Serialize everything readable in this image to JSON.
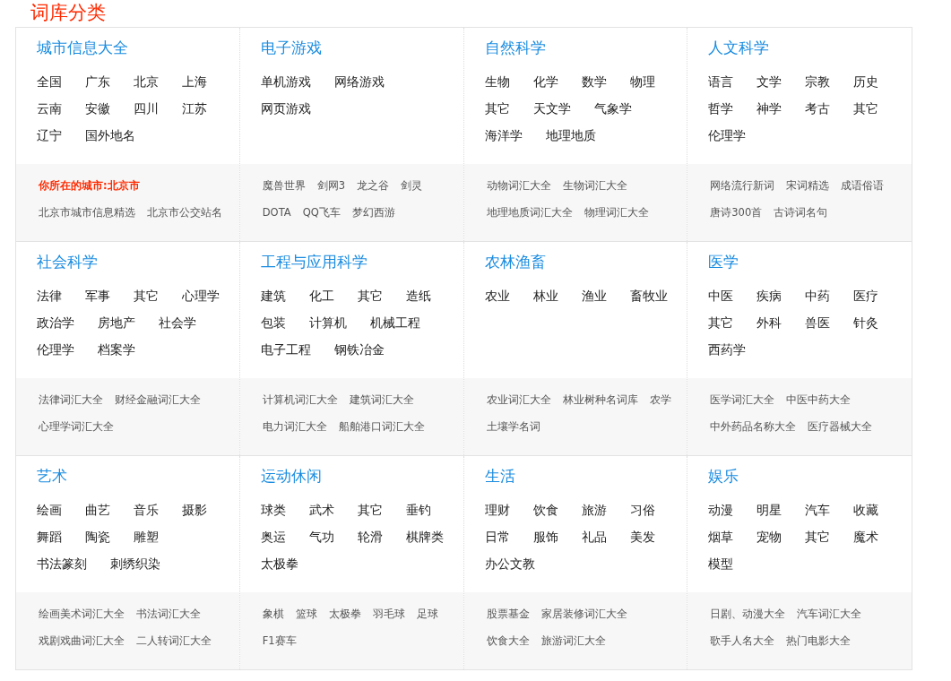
{
  "title": "词库分类",
  "categories": [
    {
      "name": "城市信息大全",
      "items": [
        "全国",
        "广东",
        "北京",
        "上海",
        "云南",
        "安徽",
        "四川",
        "江苏",
        "辽宁",
        "国外地名"
      ],
      "links": [
        [
          {
            "text": "你所在的城市:北京市",
            "kind": "location"
          }
        ],
        [
          {
            "text": "北京市城市信息精选",
            "kind": "link"
          },
          {
            "text": "北京市公交站名",
            "kind": "link"
          }
        ]
      ]
    },
    {
      "name": "电子游戏",
      "items": [
        "单机游戏",
        "网络游戏",
        "网页游戏"
      ],
      "links": [
        [
          {
            "text": "魔兽世界",
            "kind": "link"
          },
          {
            "text": "剑网3",
            "kind": "link"
          },
          {
            "text": "龙之谷",
            "kind": "link"
          },
          {
            "text": "剑灵",
            "kind": "link"
          }
        ],
        [
          {
            "text": "DOTA",
            "kind": "link"
          },
          {
            "text": "QQ飞车",
            "kind": "link"
          },
          {
            "text": "梦幻西游",
            "kind": "link"
          }
        ]
      ]
    },
    {
      "name": "自然科学",
      "items": [
        "生物",
        "化学",
        "数学",
        "物理",
        "其它",
        "天文学",
        "气象学",
        "海洋学",
        "地理地质"
      ],
      "links": [
        [
          {
            "text": "动物词汇大全",
            "kind": "link"
          },
          {
            "text": "生物词汇大全",
            "kind": "link"
          }
        ],
        [
          {
            "text": "地理地质词汇大全",
            "kind": "link"
          },
          {
            "text": "物理词汇大全",
            "kind": "link"
          }
        ]
      ]
    },
    {
      "name": "人文科学",
      "items": [
        "语言",
        "文学",
        "宗教",
        "历史",
        "哲学",
        "神学",
        "考古",
        "其它",
        "伦理学"
      ],
      "links": [
        [
          {
            "text": "网络流行新词",
            "kind": "link"
          },
          {
            "text": "宋词精选",
            "kind": "link"
          },
          {
            "text": "成语俗语",
            "kind": "link"
          }
        ],
        [
          {
            "text": "唐诗300首",
            "kind": "link"
          },
          {
            "text": "古诗词名句",
            "kind": "link"
          }
        ]
      ]
    },
    {
      "name": "社会科学",
      "items": [
        "法律",
        "军事",
        "其它",
        "心理学",
        "政治学",
        "房地产",
        "社会学",
        "伦理学",
        "档案学"
      ],
      "links": [
        [
          {
            "text": "法律词汇大全",
            "kind": "link"
          },
          {
            "text": "财经金融词汇大全",
            "kind": "link"
          }
        ],
        [
          {
            "text": "心理学词汇大全",
            "kind": "link"
          }
        ]
      ]
    },
    {
      "name": "工程与应用科学",
      "items": [
        "建筑",
        "化工",
        "其它",
        "造纸",
        "包装",
        "计算机",
        "机械工程",
        "电子工程",
        "钢铁冶金"
      ],
      "links": [
        [
          {
            "text": "计算机词汇大全",
            "kind": "link"
          },
          {
            "text": "建筑词汇大全",
            "kind": "link"
          }
        ],
        [
          {
            "text": "电力词汇大全",
            "kind": "link"
          },
          {
            "text": "船舶港口词汇大全",
            "kind": "link"
          }
        ]
      ]
    },
    {
      "name": "农林渔畜",
      "items": [
        "农业",
        "林业",
        "渔业",
        "畜牧业"
      ],
      "links": [
        [
          {
            "text": "农业词汇大全",
            "kind": "link"
          },
          {
            "text": "林业树种名词库",
            "kind": "link"
          },
          {
            "text": "农学",
            "kind": "link"
          }
        ],
        [
          {
            "text": "土壤学名词",
            "kind": "link"
          }
        ]
      ]
    },
    {
      "name": "医学",
      "items": [
        "中医",
        "疾病",
        "中药",
        "医疗",
        "其它",
        "外科",
        "兽医",
        "针灸",
        "西药学"
      ],
      "links": [
        [
          {
            "text": "医学词汇大全",
            "kind": "link"
          },
          {
            "text": "中医中药大全",
            "kind": "link"
          }
        ],
        [
          {
            "text": "中外药品名称大全",
            "kind": "link"
          },
          {
            "text": "医疗器械大全",
            "kind": "link"
          }
        ]
      ]
    },
    {
      "name": "艺术",
      "items": [
        "绘画",
        "曲艺",
        "音乐",
        "摄影",
        "舞蹈",
        "陶瓷",
        "雕塑",
        "书法篆刻",
        "刺绣织染"
      ],
      "links": [
        [
          {
            "text": "绘画美术词汇大全",
            "kind": "link"
          },
          {
            "text": "书法词汇大全",
            "kind": "link"
          }
        ],
        [
          {
            "text": "戏剧戏曲词汇大全",
            "kind": "link"
          },
          {
            "text": "二人转词汇大全",
            "kind": "link"
          }
        ]
      ]
    },
    {
      "name": "运动休闲",
      "items": [
        "球类",
        "武术",
        "其它",
        "垂钓",
        "奥运",
        "气功",
        "轮滑",
        "棋牌类",
        "太极拳"
      ],
      "links": [
        [
          {
            "text": "象棋",
            "kind": "link"
          },
          {
            "text": "篮球",
            "kind": "link"
          },
          {
            "text": "太极拳",
            "kind": "link"
          },
          {
            "text": "羽毛球",
            "kind": "link"
          },
          {
            "text": "足球",
            "kind": "link"
          }
        ],
        [
          {
            "text": "F1赛车",
            "kind": "link"
          }
        ]
      ]
    },
    {
      "name": "生活",
      "items": [
        "理财",
        "饮食",
        "旅游",
        "习俗",
        "日常",
        "服饰",
        "礼品",
        "美发",
        "办公文教"
      ],
      "links": [
        [
          {
            "text": "股票基金",
            "kind": "link"
          },
          {
            "text": "家居装修词汇大全",
            "kind": "link"
          }
        ],
        [
          {
            "text": "饮食大全",
            "kind": "link"
          },
          {
            "text": "旅游词汇大全",
            "kind": "link"
          }
        ]
      ]
    },
    {
      "name": "娱乐",
      "items": [
        "动漫",
        "明星",
        "汽车",
        "收藏",
        "烟草",
        "宠物",
        "其它",
        "魔术",
        "模型"
      ],
      "links": [
        [
          {
            "text": "日剧、动漫大全",
            "kind": "link"
          },
          {
            "text": "汽车词汇大全",
            "kind": "link"
          }
        ],
        [
          {
            "text": "歌手人名大全",
            "kind": "link"
          },
          {
            "text": "热门电影大全",
            "kind": "link"
          }
        ]
      ]
    }
  ]
}
